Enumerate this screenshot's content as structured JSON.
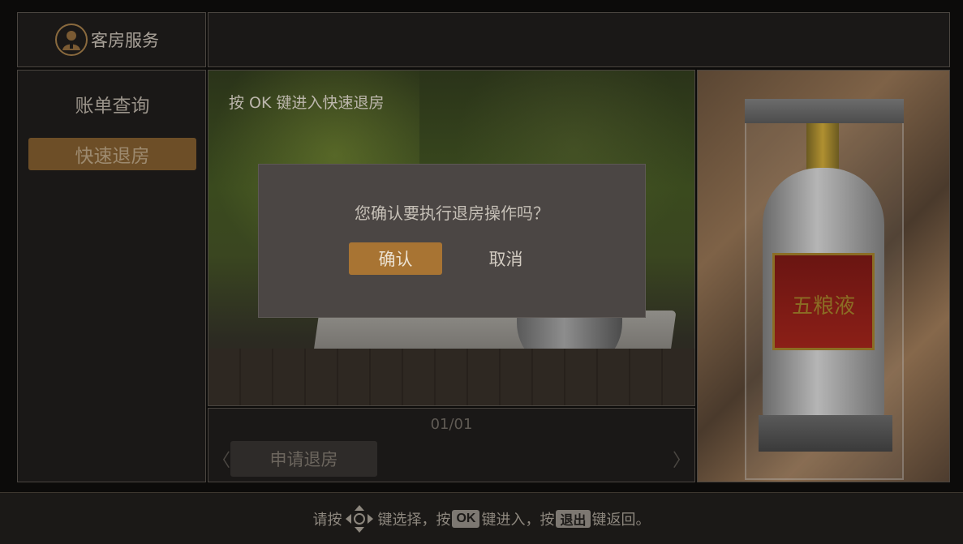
{
  "header": {
    "title": "客房服务"
  },
  "sidebar": {
    "items": [
      {
        "label": "账单查询",
        "active": false
      },
      {
        "label": "快速退房",
        "active": true
      }
    ]
  },
  "main": {
    "hint": "按 OK 键进入快速退房",
    "page_counter": "01/01",
    "prev_arrow": "〈",
    "next_arrow": "〉",
    "apply_button": "申请退房"
  },
  "ad": {
    "label_text": "五粮液"
  },
  "dialog": {
    "message": "您确认要执行退房操作吗？",
    "confirm": "确认",
    "cancel": "取消"
  },
  "footer": {
    "part1": "请按",
    "part2": "键选择，按",
    "ok_key": "OK",
    "part3": "键进入，按",
    "exit_key": "退出",
    "part4": "键返回。"
  },
  "colors": {
    "accent": "#a87433",
    "active_menu": "#6d4e27",
    "panel_bg": "#1a1817"
  },
  "icons": [
    "concierge-icon",
    "dpad-icon"
  ]
}
